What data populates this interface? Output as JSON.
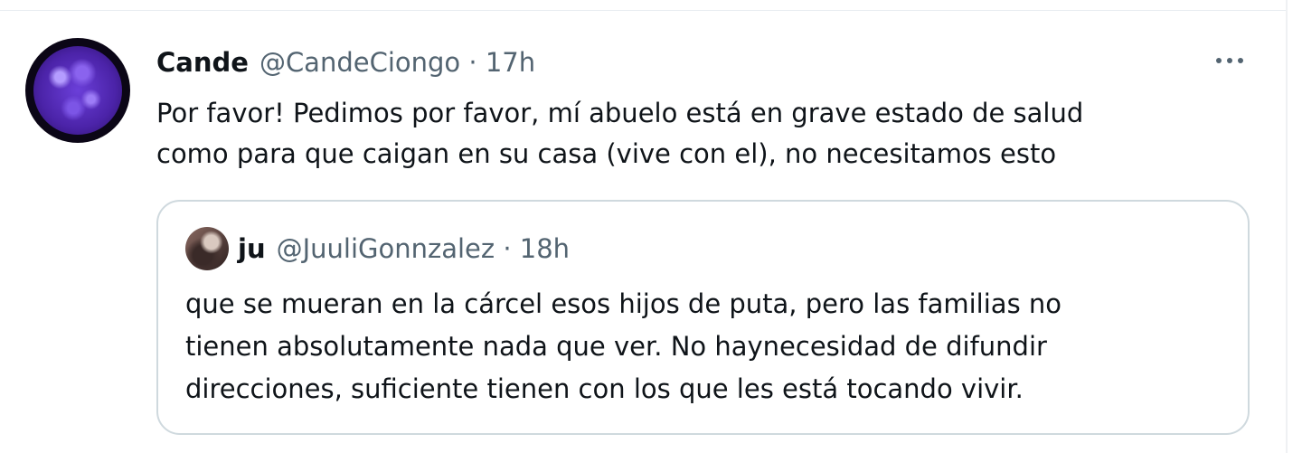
{
  "tweet": {
    "display_name": "Cande",
    "meta": "@CandeCiongo · 17h",
    "text_lines": [
      "Por favor! Pedimos por favor, mí  abuelo está en grave estado de salud",
      "como para que caigan en su casa (vive con el), no necesitamos esto"
    ],
    "more_icon": "more-horizontal-icon"
  },
  "quote": {
    "display_name": "ju",
    "meta": "@JuuliGonnzalez · 18h",
    "text_lines": [
      "que se mueran en la cárcel esos hijos de puta, pero las familias no",
      "tienen absolutamente nada que ver. No haynecesidad de difundir",
      "direcciones, suficiente tienen con los que les está tocando vivir."
    ]
  },
  "colors": {
    "text": "#0f1419",
    "secondary": "#536471",
    "border": "#cfd9de"
  }
}
